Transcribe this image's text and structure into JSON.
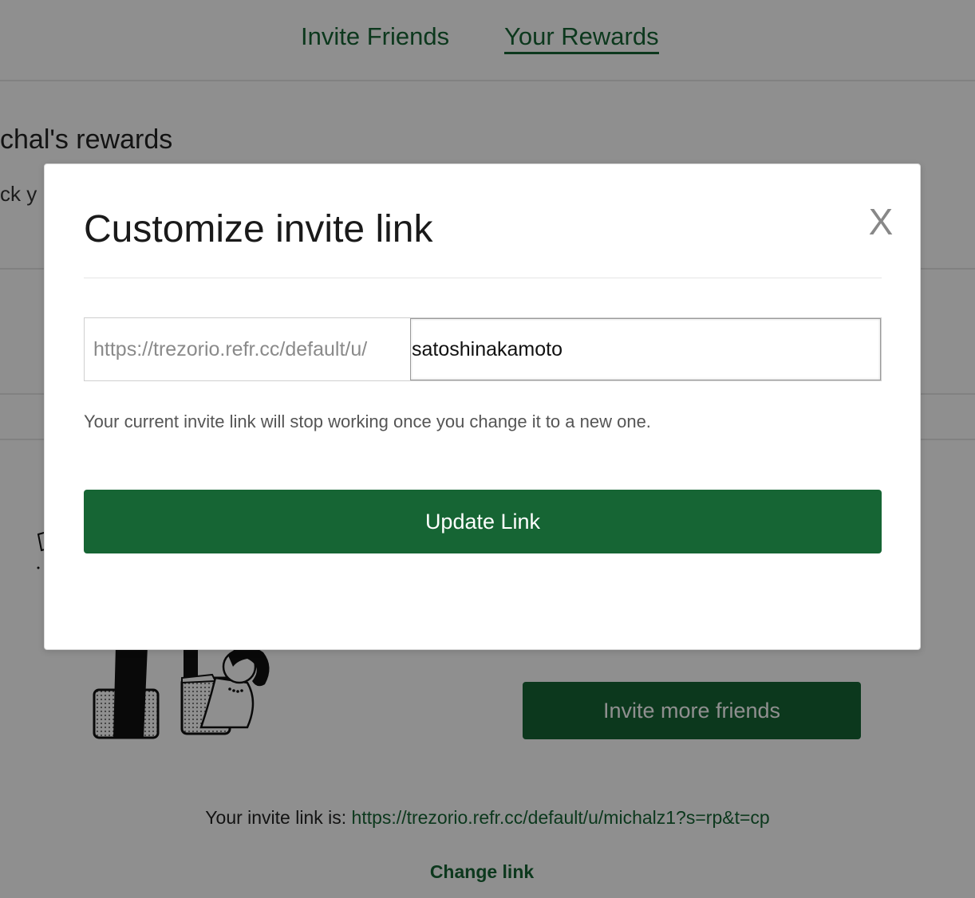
{
  "nav": {
    "tabs": [
      {
        "label": "Invite Friends",
        "active": false
      },
      {
        "label": "Your Rewards",
        "active": true
      }
    ]
  },
  "rewards": {
    "title": "chal's rewards",
    "subtitle": "ck y"
  },
  "main": {
    "invite_more_label": "Invite more friends",
    "invite_link_prefix": "Your invite link is: ",
    "invite_link_url": "https://trezorio.refr.cc/default/u/michalz1?s=rp&t=cp",
    "change_link_label": "Change link"
  },
  "modal": {
    "title": "Customize invite link",
    "close_label": "X",
    "url_prefix": "https://trezorio.refr.cc/default/u/",
    "url_value": "satoshinakamoto",
    "helper_text": "Your current invite link will stop working once you change it to a new one.",
    "update_label": "Update Link"
  },
  "colors": {
    "brand_green": "#166534",
    "overlay": "rgba(0,0,0,0.44)"
  }
}
